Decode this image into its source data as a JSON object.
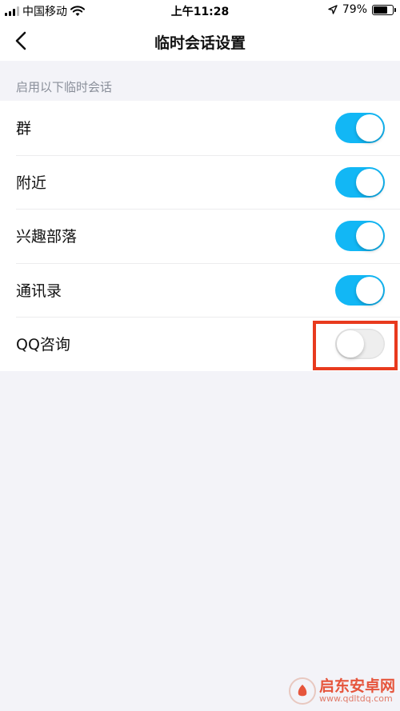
{
  "status_bar": {
    "carrier": "中国移动",
    "time": "上午11:28",
    "battery_text": "79%",
    "battery_level": 0.79
  },
  "nav": {
    "title": "临时会话设置",
    "back_icon": "chevron-left-icon"
  },
  "section": {
    "header": "启用以下临时会话"
  },
  "settings": [
    {
      "label": "群",
      "enabled": true
    },
    {
      "label": "附近",
      "enabled": true
    },
    {
      "label": "兴趣部落",
      "enabled": true
    },
    {
      "label": "通讯录",
      "enabled": true
    },
    {
      "label": "QQ咨询",
      "enabled": false
    }
  ],
  "colors": {
    "toggle_on": "#12b7f5",
    "toggle_off": "#eeeeee",
    "highlight": "#e83a1e",
    "background": "#f3f3f8"
  },
  "watermark": {
    "main": "启东安卓网",
    "sub": "www.qdltdq.com"
  }
}
